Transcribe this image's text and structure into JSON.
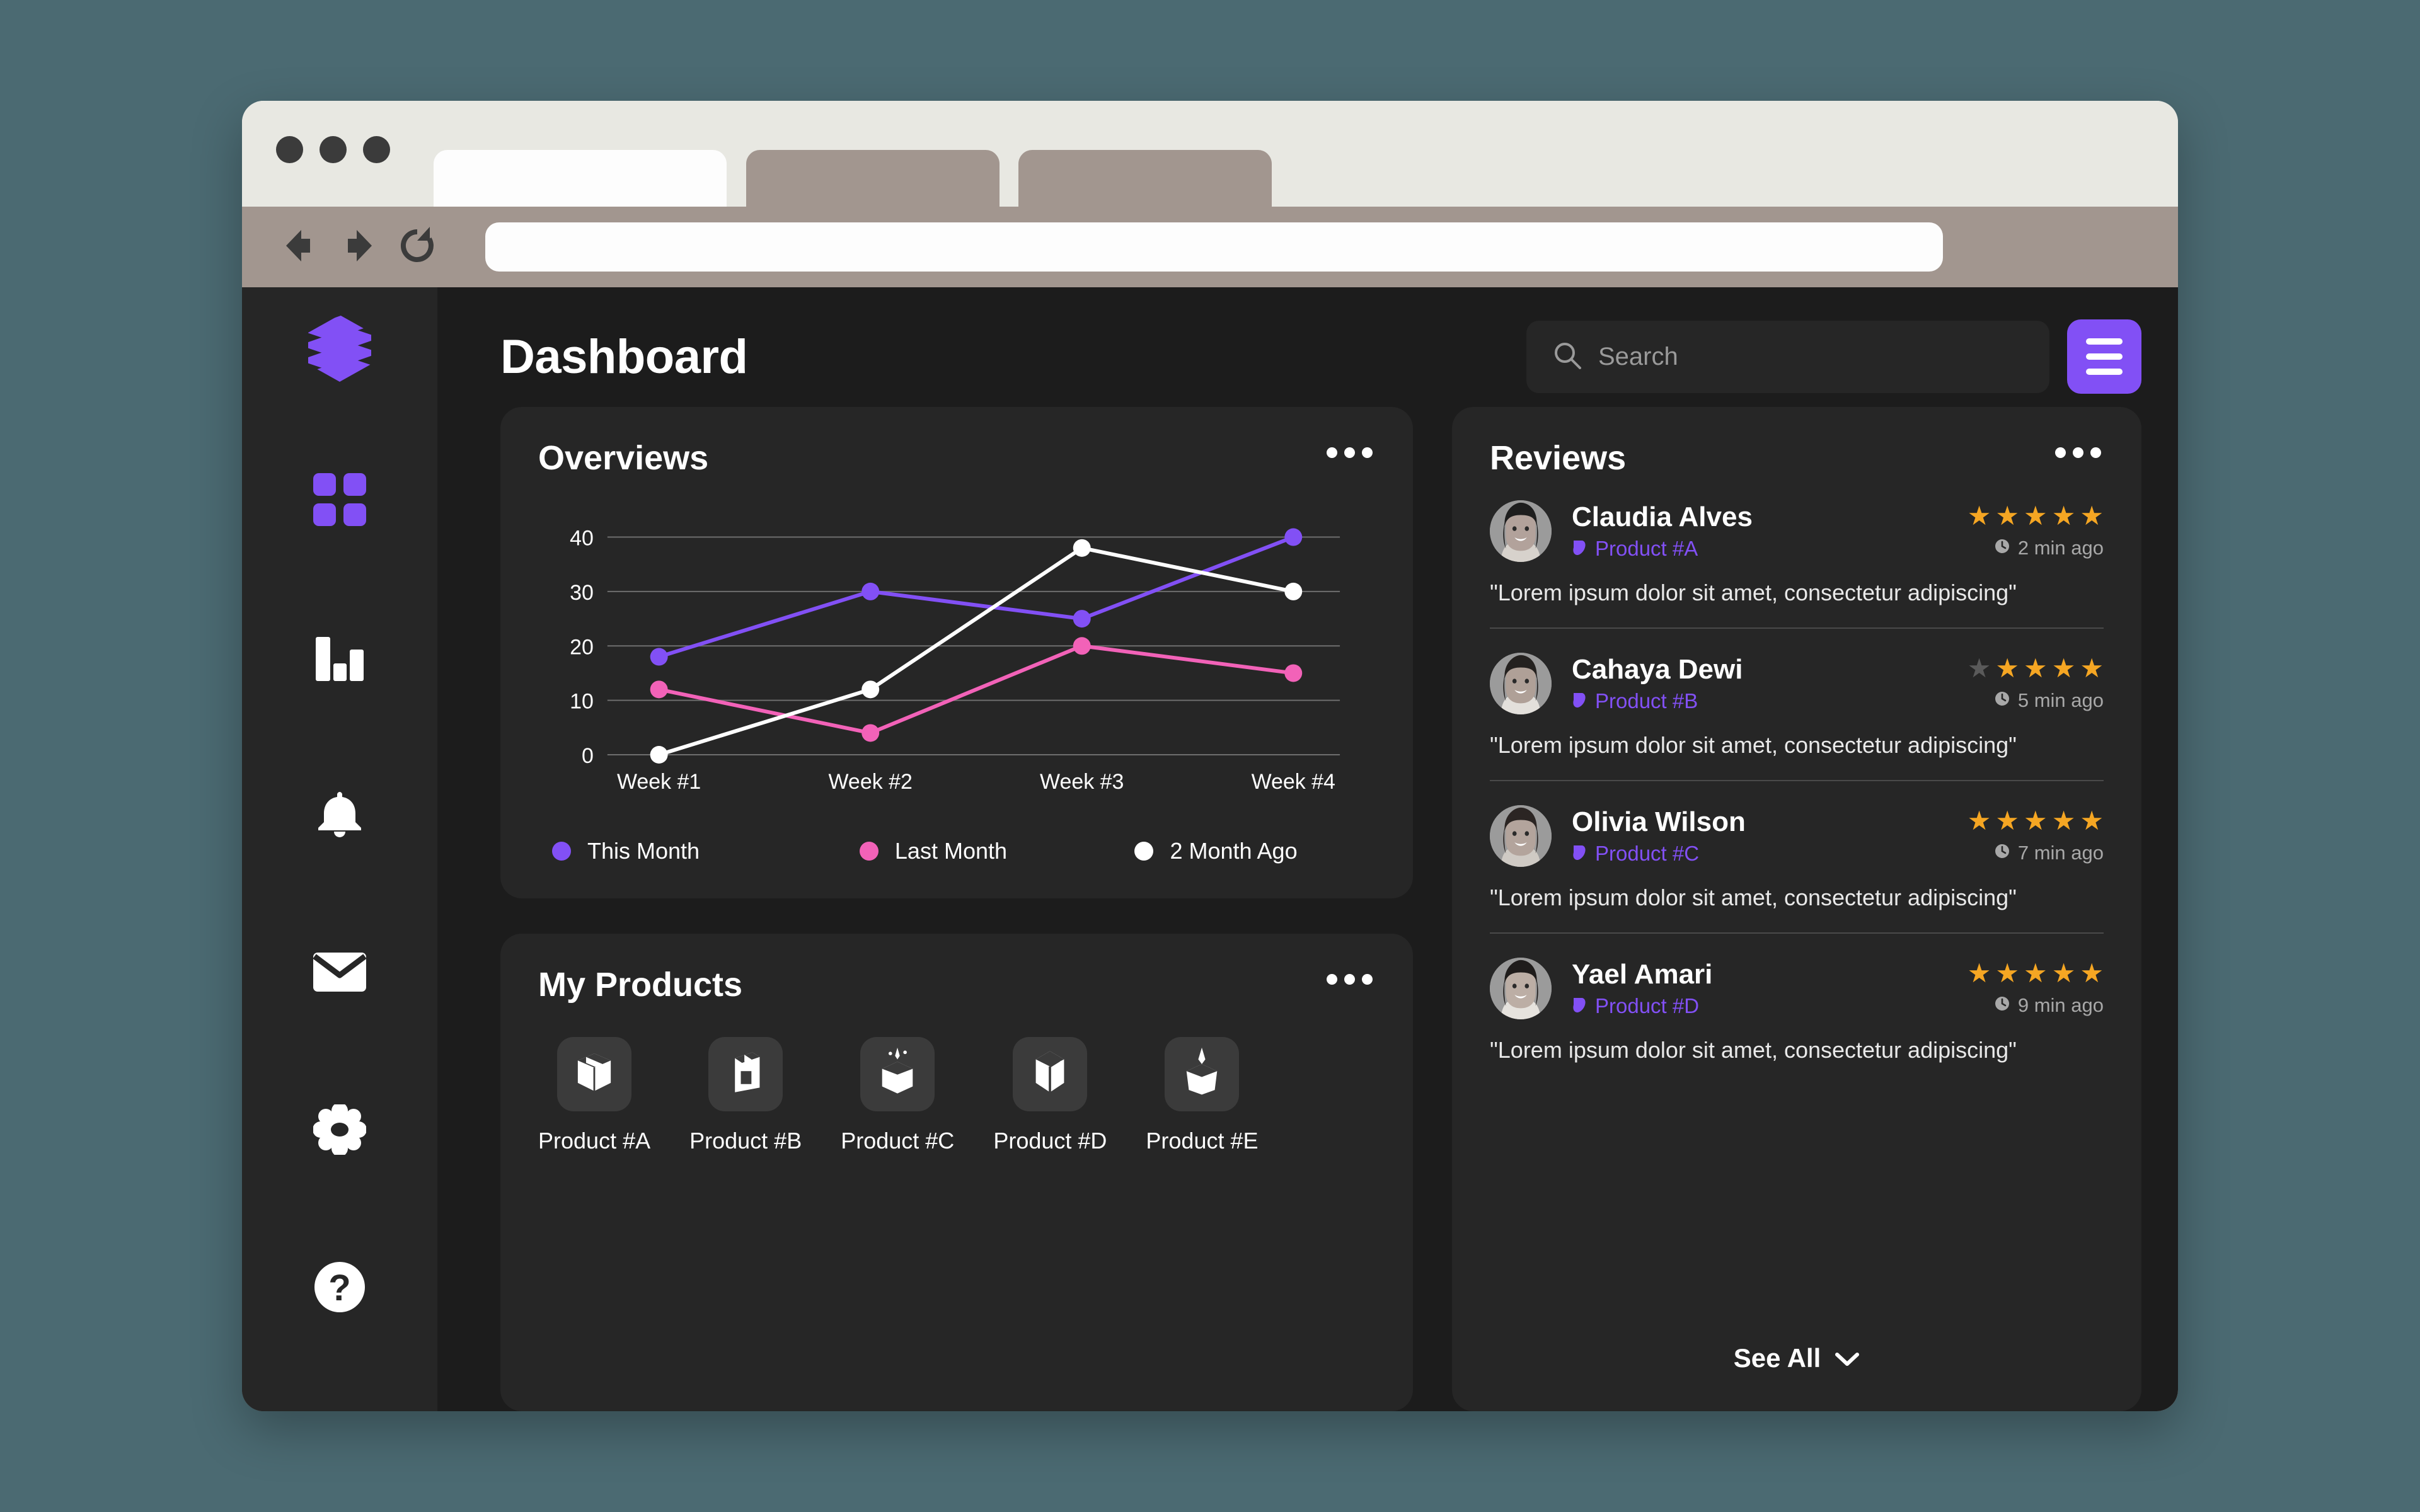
{
  "browser": {
    "tabs": [
      {
        "label": "",
        "active": true
      },
      {
        "label": "",
        "active": false
      },
      {
        "label": "",
        "active": false
      }
    ],
    "url_value": "",
    "url_placeholder": ""
  },
  "colors": {
    "accent_purple": "#8250F5",
    "accent_pink": "#F262B8",
    "series_white": "#FFFFFF",
    "star_gold": "#F5A623",
    "star_off": "#5A5A5A",
    "page_bg": "#1C1C1C",
    "card_bg": "#262626",
    "desktop_bg": "#4B6A72"
  },
  "sidebar": {
    "brand": "logo-s-hex",
    "items": [
      {
        "icon": "grid-dashboard-icon",
        "label": "Dashboard",
        "active": true
      },
      {
        "icon": "bar-chart-icon",
        "label": "Analytics",
        "active": false
      },
      {
        "icon": "bell-icon",
        "label": "Notifications",
        "active": false
      },
      {
        "icon": "mail-icon",
        "label": "Messages",
        "active": false
      },
      {
        "icon": "gear-icon",
        "label": "Settings",
        "active": false
      },
      {
        "icon": "help-question-icon",
        "label": "Help",
        "active": false
      }
    ]
  },
  "header": {
    "title": "Dashboard",
    "search_placeholder": "Search",
    "search_value": "",
    "menu_button": "hamburger-menu"
  },
  "overviews": {
    "title": "Overviews",
    "menu": "more-options"
  },
  "chart_data": {
    "type": "line",
    "title": "Overviews",
    "xlabel": "",
    "ylabel": "",
    "categories": [
      "Week #1",
      "Week #2",
      "Week #3",
      "Week #4"
    ],
    "yticks": [
      0,
      10,
      20,
      30,
      40
    ],
    "ylim": [
      0,
      44
    ],
    "grid": true,
    "legend_position": "bottom",
    "series": [
      {
        "name": "This Month",
        "color": "#8250F5",
        "values": [
          18,
          30,
          25,
          40
        ]
      },
      {
        "name": "Last Month",
        "color": "#F262B8",
        "values": [
          12,
          4,
          20,
          15
        ]
      },
      {
        "name": "2 Month Ago",
        "color": "#FFFFFF",
        "values": [
          0,
          12,
          38,
          30
        ]
      }
    ]
  },
  "my_products": {
    "title": "My Products",
    "menu": "more-options",
    "items": [
      {
        "label": "Product #A",
        "icon": "box-open-icon"
      },
      {
        "label": "Product #B",
        "icon": "box-carton-icon"
      },
      {
        "label": "Product #C",
        "icon": "box-sparkle-icon"
      },
      {
        "label": "Product #D",
        "icon": "box-closed-icon"
      },
      {
        "label": "Product #E",
        "icon": "box-star-icon"
      }
    ]
  },
  "reviews": {
    "title": "Reviews",
    "menu": "more-options",
    "see_all_label": "See All",
    "items": [
      {
        "name": "Claudia Alves",
        "product": "Product #A",
        "rating": 5,
        "max_rating": 5,
        "time": "2 min ago",
        "text": "\"Lorem ipsum dolor sit amet, consectetur adipiscing\""
      },
      {
        "name": "Cahaya Dewi",
        "product": "Product #B",
        "rating": 4,
        "max_rating": 5,
        "time": "5 min ago",
        "text": "\"Lorem ipsum dolor sit amet, consectetur adipiscing\""
      },
      {
        "name": "Olivia Wilson",
        "product": "Product #C",
        "rating": 5,
        "max_rating": 5,
        "time": "7 min ago",
        "text": "\"Lorem ipsum dolor sit amet, consectetur adipiscing\""
      },
      {
        "name": "Yael Amari",
        "product": "Product #D",
        "rating": 5,
        "max_rating": 5,
        "time": "9 min ago",
        "text": "\"Lorem ipsum dolor sit amet, consectetur adipiscing\""
      }
    ]
  }
}
